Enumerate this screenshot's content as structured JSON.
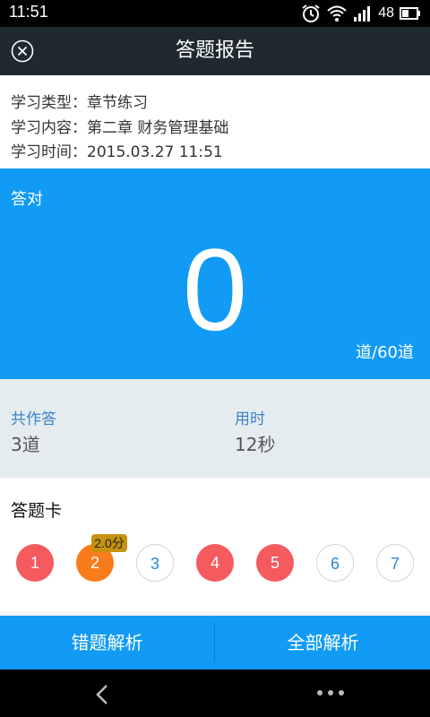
{
  "status_bar": {
    "time": "11:51",
    "battery": "48",
    "icons": [
      "alarm-clock-icon",
      "wifi-icon",
      "signal-icon",
      "battery-icon"
    ]
  },
  "app_bar": {
    "title": "答题报告",
    "close_icon": "close-icon"
  },
  "info": {
    "type": "学习类型：章节练习",
    "content": "学习内容：第二章 财务管理基础",
    "time": "学习时间：2015.03.27 11:51"
  },
  "score": {
    "label": "答对",
    "correct": "0",
    "total": "道/60道"
  },
  "stats": {
    "answered_label": "共作答",
    "answered_value": "3道",
    "time_label": "用时",
    "time_value": "12秒"
  },
  "answer_card": {
    "title": "答题卡",
    "tooltip": "2.0分",
    "items": [
      {
        "num": "1",
        "state": "wrong"
      },
      {
        "num": "2",
        "state": "partial"
      },
      {
        "num": "3",
        "state": "empty"
      },
      {
        "num": "4",
        "state": "wrong"
      },
      {
        "num": "5",
        "state": "wrong"
      },
      {
        "num": "6",
        "state": "empty"
      },
      {
        "num": "7",
        "state": "empty"
      }
    ]
  },
  "actions": {
    "wrong_analysis": "错题解析",
    "all_analysis": "全部解析"
  },
  "colors": {
    "primary": "#119bf5",
    "header": "#1f2a30",
    "wrong": "#f55a5f",
    "partial": "#f97c1b",
    "tooltip": "#c7920f"
  }
}
